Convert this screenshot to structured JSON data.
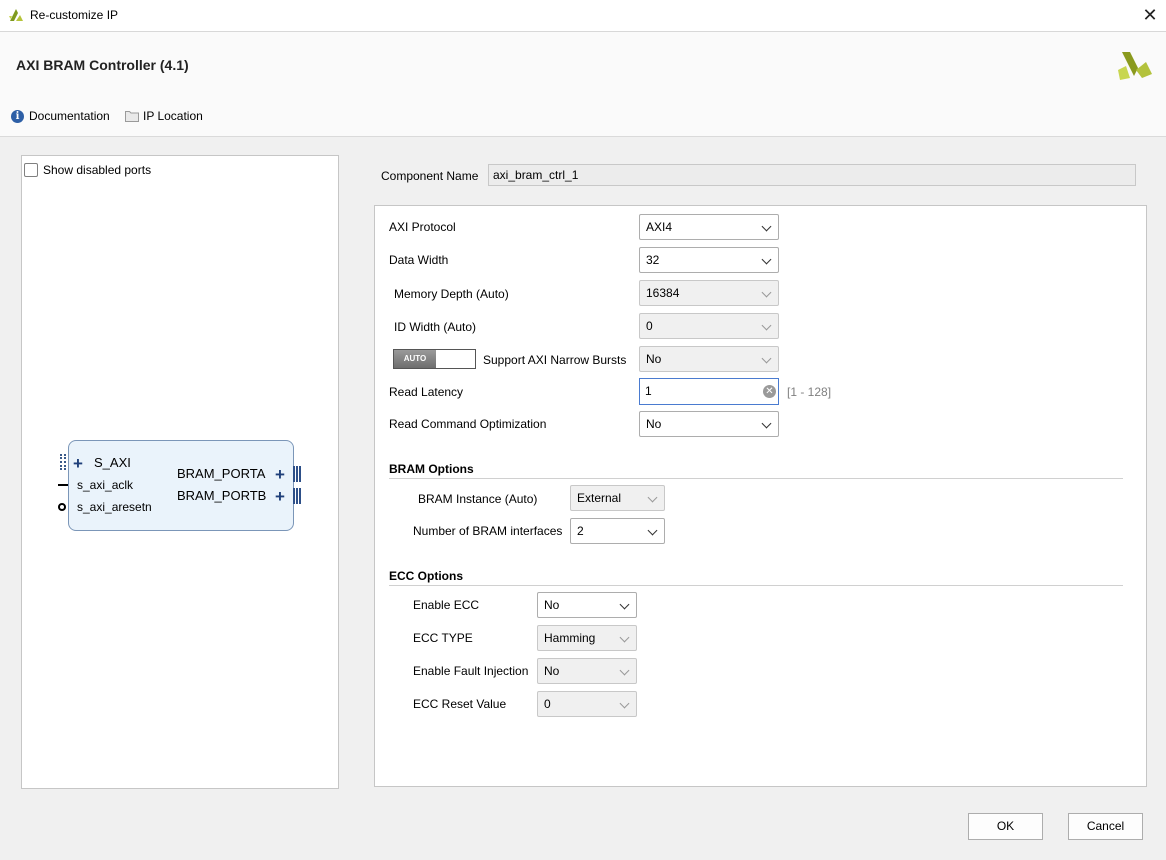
{
  "window": {
    "title": "Re-customize IP"
  },
  "header": {
    "ip_title": "AXI BRAM Controller (4.1)",
    "documentation_label": "Documentation",
    "ip_location_label": "IP Location"
  },
  "left_panel": {
    "show_disabled_ports_label": "Show disabled ports",
    "show_disabled_ports_checked": false,
    "block": {
      "left_ports": [
        "S_AXI",
        "s_axi_aclk",
        "s_axi_aresetn"
      ],
      "right_ports": [
        "BRAM_PORTA",
        "BRAM_PORTB"
      ]
    }
  },
  "component": {
    "label": "Component Name",
    "value": "axi_bram_ctrl_1"
  },
  "params": {
    "axi_protocol": {
      "label": "AXI Protocol",
      "value": "AXI4"
    },
    "data_width": {
      "label": "Data Width",
      "value": "32"
    },
    "memory_depth": {
      "label": "Memory Depth (Auto)",
      "value": "16384"
    },
    "id_width": {
      "label": "ID Width (Auto)",
      "value": "0"
    },
    "narrow_bursts": {
      "label": "Support AXI Narrow Bursts",
      "value": "No",
      "toggle_label": "AUTO"
    },
    "read_latency": {
      "label": "Read Latency",
      "value": "1",
      "range": "[1 - 128]"
    },
    "read_cmd_opt": {
      "label": "Read Command Optimization",
      "value": "No"
    }
  },
  "bram_options": {
    "title": "BRAM Options",
    "instance": {
      "label": "BRAM Instance (Auto)",
      "value": "External"
    },
    "num_interfaces": {
      "label": "Number of BRAM interfaces",
      "value": "2"
    }
  },
  "ecc_options": {
    "title": "ECC Options",
    "enable_ecc": {
      "label": "Enable ECC",
      "value": "No"
    },
    "ecc_type": {
      "label": "ECC TYPE",
      "value": "Hamming"
    },
    "fault_injection": {
      "label": "Enable Fault Injection",
      "value": "No"
    },
    "reset_value": {
      "label": "ECC Reset Value",
      "value": "0"
    }
  },
  "footer": {
    "ok_label": "OK",
    "cancel_label": "Cancel"
  },
  "colors": {
    "accent": "#4a7bd0",
    "brand": "#8a9a1e",
    "block_fill": "#eaf3fb"
  }
}
